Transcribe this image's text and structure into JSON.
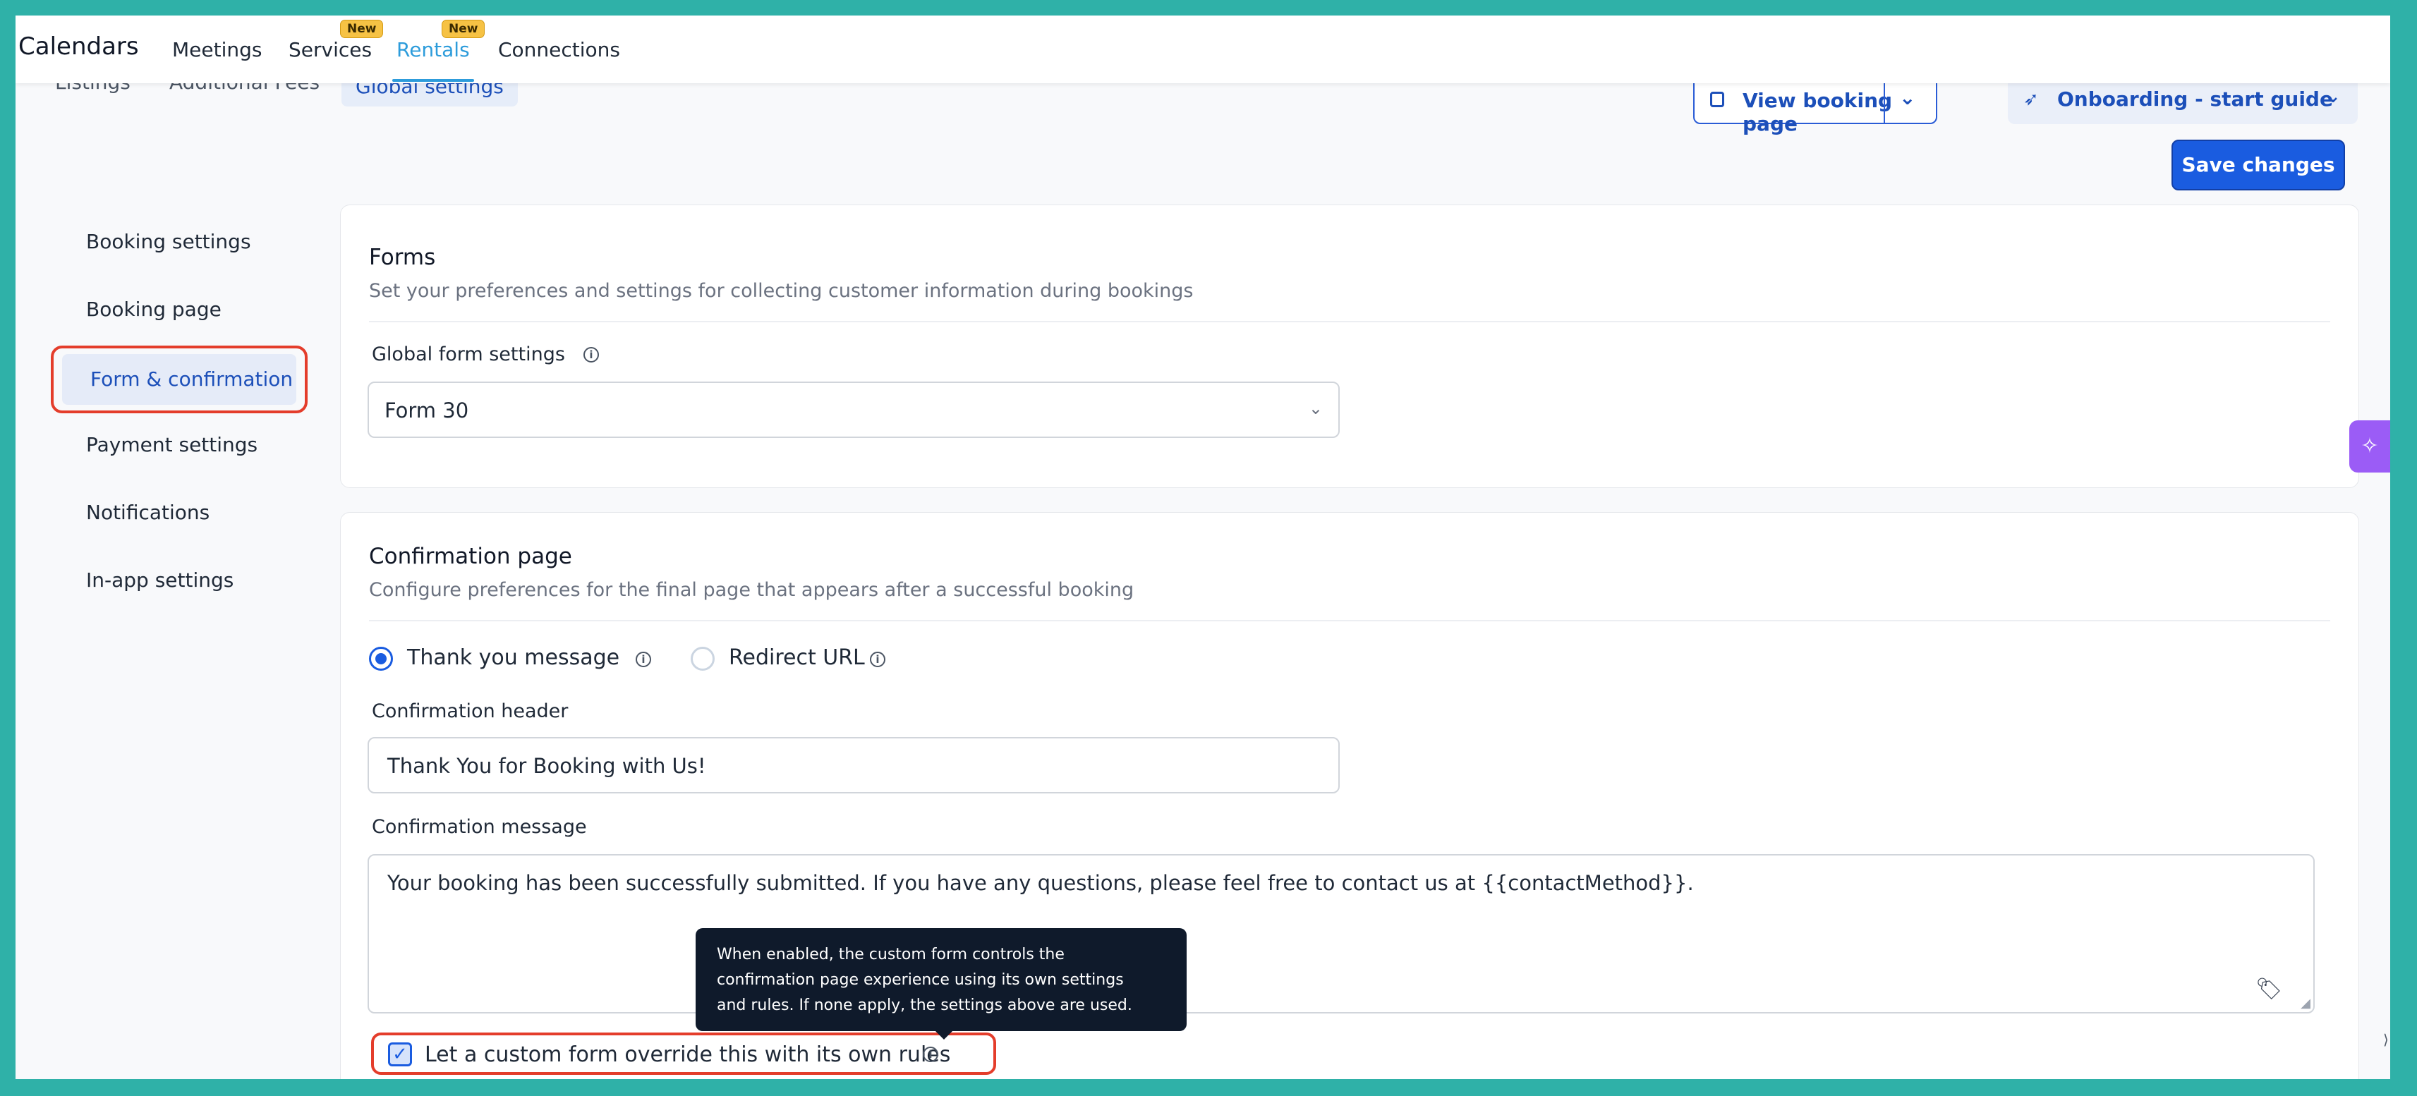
{
  "app": {
    "title": "Calendars"
  },
  "nav": {
    "items": [
      {
        "label": "Meetings"
      },
      {
        "label": "Services",
        "badge": "New"
      },
      {
        "label": "Rentals",
        "badge": "New",
        "active": true
      },
      {
        "label": "Connections"
      }
    ]
  },
  "subtabs": [
    {
      "label": "Listings"
    },
    {
      "label": "Additional Fees"
    },
    {
      "label": "Global settings",
      "active": true
    }
  ],
  "header_actions": {
    "view_booking_page": "View booking page",
    "onboarding": "Onboarding - start guide"
  },
  "save_button": "Save changes",
  "sidebar": {
    "items": [
      {
        "label": "Booking settings"
      },
      {
        "label": "Booking page"
      },
      {
        "label": "Form & confirmation",
        "active": true
      },
      {
        "label": "Payment settings"
      },
      {
        "label": "Notifications"
      },
      {
        "label": "In-app settings"
      }
    ]
  },
  "forms_card": {
    "title": "Forms",
    "subtitle": "Set your preferences and settings for collecting customer information during bookings",
    "field_label": "Global form settings",
    "selected_form": "Form 30"
  },
  "confirmation_card": {
    "title": "Confirmation page",
    "subtitle": "Configure preferences for the final page that appears after a successful booking",
    "options": [
      {
        "label": "Thank you message",
        "selected": true
      },
      {
        "label": "Redirect URL",
        "selected": false
      }
    ],
    "header_label": "Confirmation header",
    "header_value": "Thank You for Booking with Us!",
    "message_label": "Confirmation message",
    "message_value": "Your booking has been successfully submitted. If you have any questions, please feel free to contact us at {{contactMethod}}.",
    "override_label": "Let a custom form override this with its own rules",
    "override_checked": true,
    "tooltip_lines": [
      "When enabled, the custom form controls the",
      "confirmation page experience using its own settings",
      "and rules. If none apply, the settings above are used."
    ]
  },
  "colors": {
    "accent": "#1a5ce0",
    "nav_active": "#2d9cdb",
    "highlight": "#e43d2b",
    "frame": "#2fb1a8",
    "widget": "#9b5cf6"
  },
  "icons": {
    "info": "info-icon",
    "chevron": "chevron-down-icon",
    "tag": "tag-icon",
    "check": "check-icon",
    "sparkle": "sparkle-icon"
  }
}
